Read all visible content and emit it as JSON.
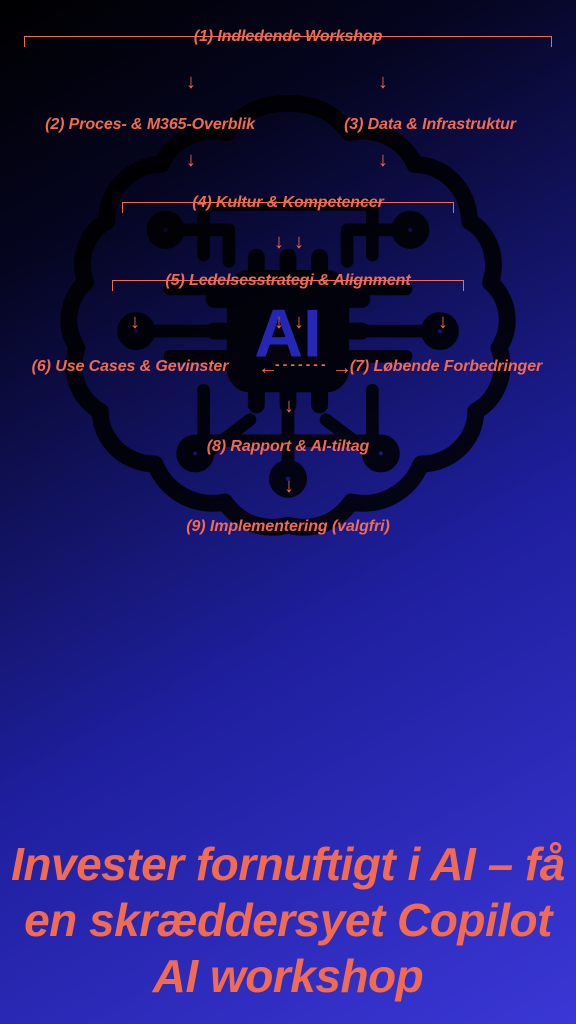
{
  "steps": {
    "s1": "(1) Indledende Workshop",
    "s2": "(2) Proces- & M365-Overblik",
    "s3": "(3) Data & Infrastruktur",
    "s4": "(4) Kultur & Kompetencer",
    "s5": "(5) Ledelsesstrategi & Alignment",
    "s6": "(6) Use Cases & Gevinster",
    "s7": "(7) Løbende Forbedringer",
    "s8": "(8) Rapport & AI-tiltag",
    "s9": "(9) Implementering (valgfri)"
  },
  "headline": "Invester fornuftigt i AI – få en skræddersyet Copilot AI workshop"
}
